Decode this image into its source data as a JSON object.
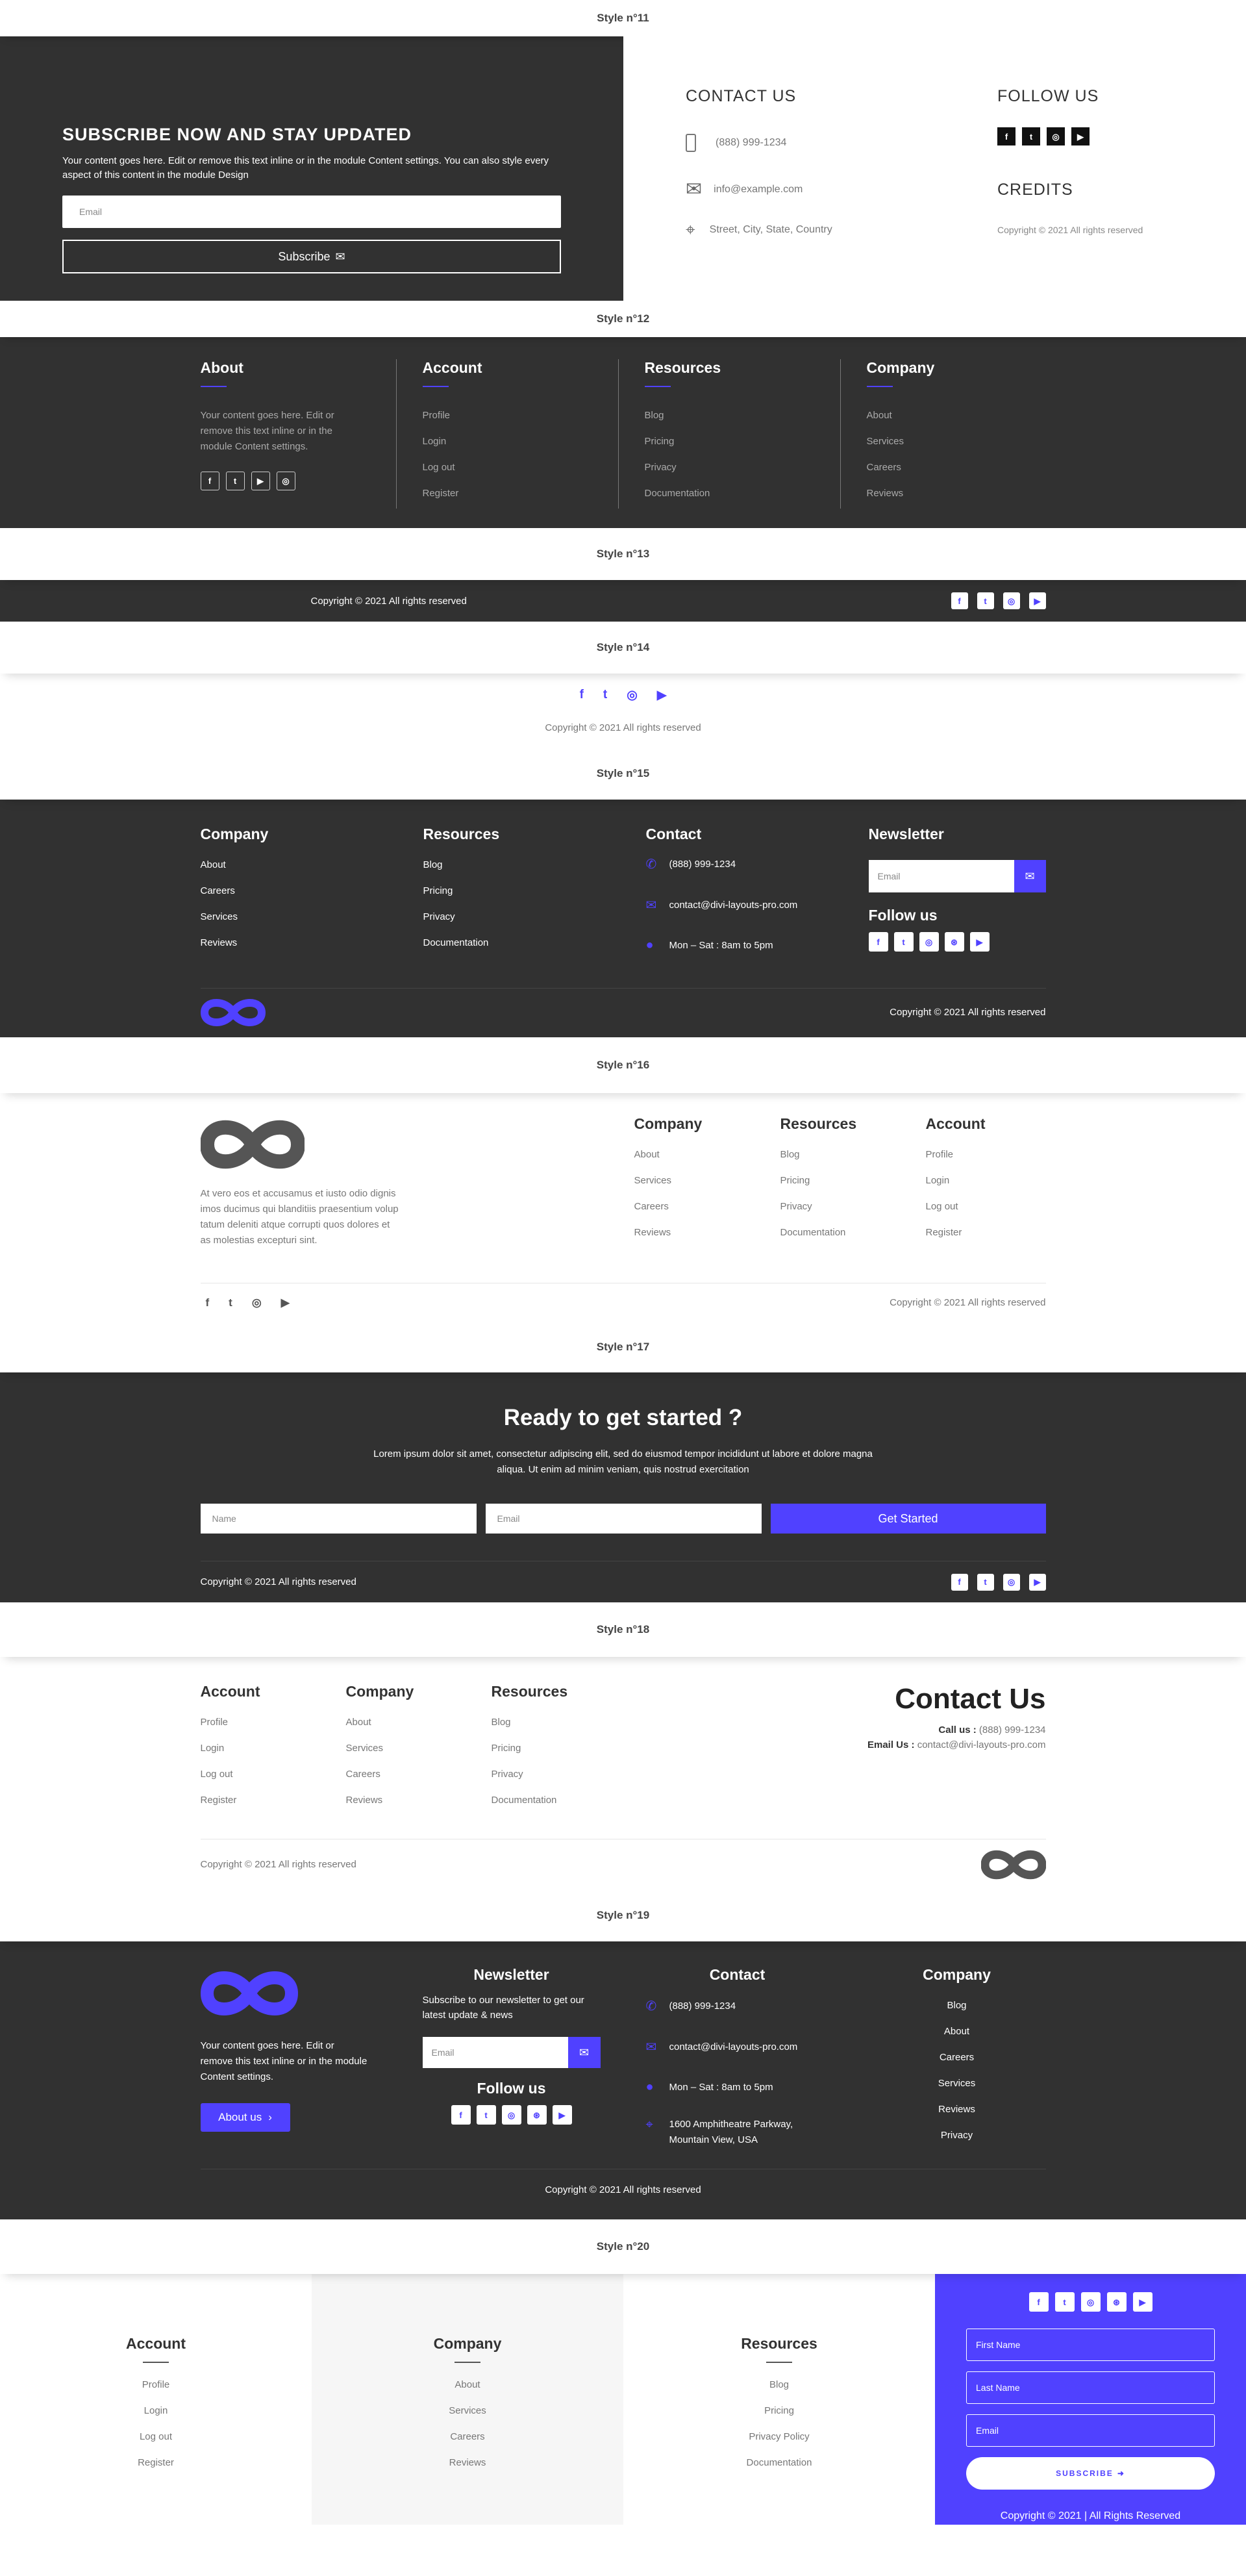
{
  "copyright": "Copyright © 2021 All rights reserved",
  "s11": {
    "label": "Style n°11",
    "heading": "SUBSCRIBE NOW AND STAY UPDATED",
    "text": "Your content goes here. Edit or remove this text inline or in the module Content settings. You can also style every aspect of this content in the module Design",
    "email_placeholder": "Email",
    "button": "Subscribe",
    "contact_heading": "CONTACT US",
    "phone": "(888) 999-1234",
    "email": "info@example.com",
    "address": "Street, City, State, Country",
    "follow_heading": "FOLLOW US",
    "credits_heading": "CREDITS"
  },
  "s12": {
    "label": "Style n°12",
    "about_title": "About",
    "about_text": "Your content goes here. Edit or remove this text inline or in the module Content settings.",
    "cols": [
      {
        "title": "Account",
        "links": [
          "Profile",
          "Login",
          "Log out",
          "Register"
        ]
      },
      {
        "title": "Resources",
        "links": [
          "Blog",
          "Pricing",
          "Privacy",
          "Documentation"
        ]
      },
      {
        "title": "Company",
        "links": [
          "About",
          "Services",
          "Careers",
          "Reviews"
        ]
      }
    ]
  },
  "s13": {
    "label": "Style n°13"
  },
  "s14": {
    "label": "Style n°14"
  },
  "s15": {
    "label": "Style n°15",
    "company_title": "Company",
    "company_links": [
      "About",
      "Careers",
      "Services",
      "Reviews"
    ],
    "resources_title": "Resources",
    "resources_links": [
      "Blog",
      "Pricing",
      "Privacy",
      "Documentation"
    ],
    "contact_title": "Contact",
    "phone": "(888) 999-1234",
    "email": "contact@divi-layouts-pro.com",
    "hours": "Mon – Sat : 8am to 5pm",
    "newsletter_title": "Newsletter",
    "email_placeholder": "Email",
    "follow_title": "Follow us"
  },
  "s16": {
    "label": "Style n°16",
    "text": "At vero eos et accusamus et iusto odio dignissimos ducimus qui blanditiis praesentium voluptatum deleniti atque corrupti quos dolores et quas molestias excepturi sint.",
    "text_lines": [
      "At vero eos et accusamus et iusto odio dignis",
      "imos ducimus qui blanditiis praesentium volup",
      "tatum deleniti atque corrupti quos dolores et",
      "as molestias excepturi sint."
    ],
    "cols": [
      {
        "title": "Company",
        "links": [
          "About",
          "Services",
          "Careers",
          "Reviews"
        ]
      },
      {
        "title": "Resources",
        "links": [
          "Blog",
          "Pricing",
          "Privacy",
          "Documentation"
        ]
      },
      {
        "title": "Account",
        "links": [
          "Profile",
          "Login",
          "Log out",
          "Register"
        ]
      }
    ]
  },
  "s17": {
    "label": "Style n°17",
    "heading": "Ready to get started ?",
    "text_line1": "Lorem ipsum dolor sit amet, consectetur adipiscing elit, sed do eiusmod tempor incididunt ut labore et dolore magna",
    "text_line2": "aliqua. Ut enim ad minim veniam, quis nostrud exercitation",
    "name_placeholder": "Name",
    "email_placeholder": "Email",
    "button": "Get Started"
  },
  "s18": {
    "label": "Style n°18",
    "cols": [
      {
        "title": "Account",
        "links": [
          "Profile",
          "Login",
          "Log out",
          "Register"
        ]
      },
      {
        "title": "Company",
        "links": [
          "About",
          "Services",
          "Careers",
          "Reviews"
        ]
      },
      {
        "title": "Resources",
        "links": [
          "Blog",
          "Pricing",
          "Privacy",
          "Documentation"
        ]
      }
    ],
    "contact_title": "Contact Us",
    "call_label": "Call us :",
    "call_value": "(888) 999-1234",
    "email_label": "Email Us :",
    "email_value": "contact@divi-layouts-pro.com"
  },
  "s19": {
    "label": "Style n°19",
    "text": "Your content goes here. Edit or remove this text inline or in the module Content settings.",
    "about_button": "About us",
    "newsletter_title": "Newsletter",
    "newsletter_text": "Subscribe to our newsletter to get our latest update & news",
    "email_placeholder": "Email",
    "follow_title": "Follow us",
    "contact_title": "Contact",
    "phone": "(888) 999-1234",
    "email": "contact@divi-layouts-pro.com",
    "hours": "Mon – Sat : 8am to 5pm",
    "address_line1": "1600 Amphitheatre Parkway,",
    "address_line2": "Mountain View, USA",
    "company_title": "Company",
    "company_links": [
      "Blog",
      "About",
      "Careers",
      "Services",
      "Reviews",
      "Privacy"
    ]
  },
  "s20": {
    "label": "Style n°20",
    "cols": [
      {
        "title": "Account",
        "links": [
          "Profile",
          "Login",
          "Log out",
          "Register"
        ]
      },
      {
        "title": "Company",
        "links": [
          "About",
          "Services",
          "Careers",
          "Reviews"
        ]
      },
      {
        "title": "Resources",
        "links": [
          "Blog",
          "Pricing",
          "Privacy Policy",
          "Documentation"
        ]
      }
    ],
    "first_name": "First Name",
    "last_name": "Last Name",
    "email": "Email",
    "subscribe": "SUBSCRIBE",
    "copyright": "Copyright © 2021 | All Rights Reserved"
  },
  "social": {
    "facebook": "f",
    "twitter": "t",
    "instagram": "◎",
    "dribbble": "⊛",
    "youtube": "▶"
  },
  "colors": {
    "accent": "#5041ff",
    "dark": "#313131"
  }
}
